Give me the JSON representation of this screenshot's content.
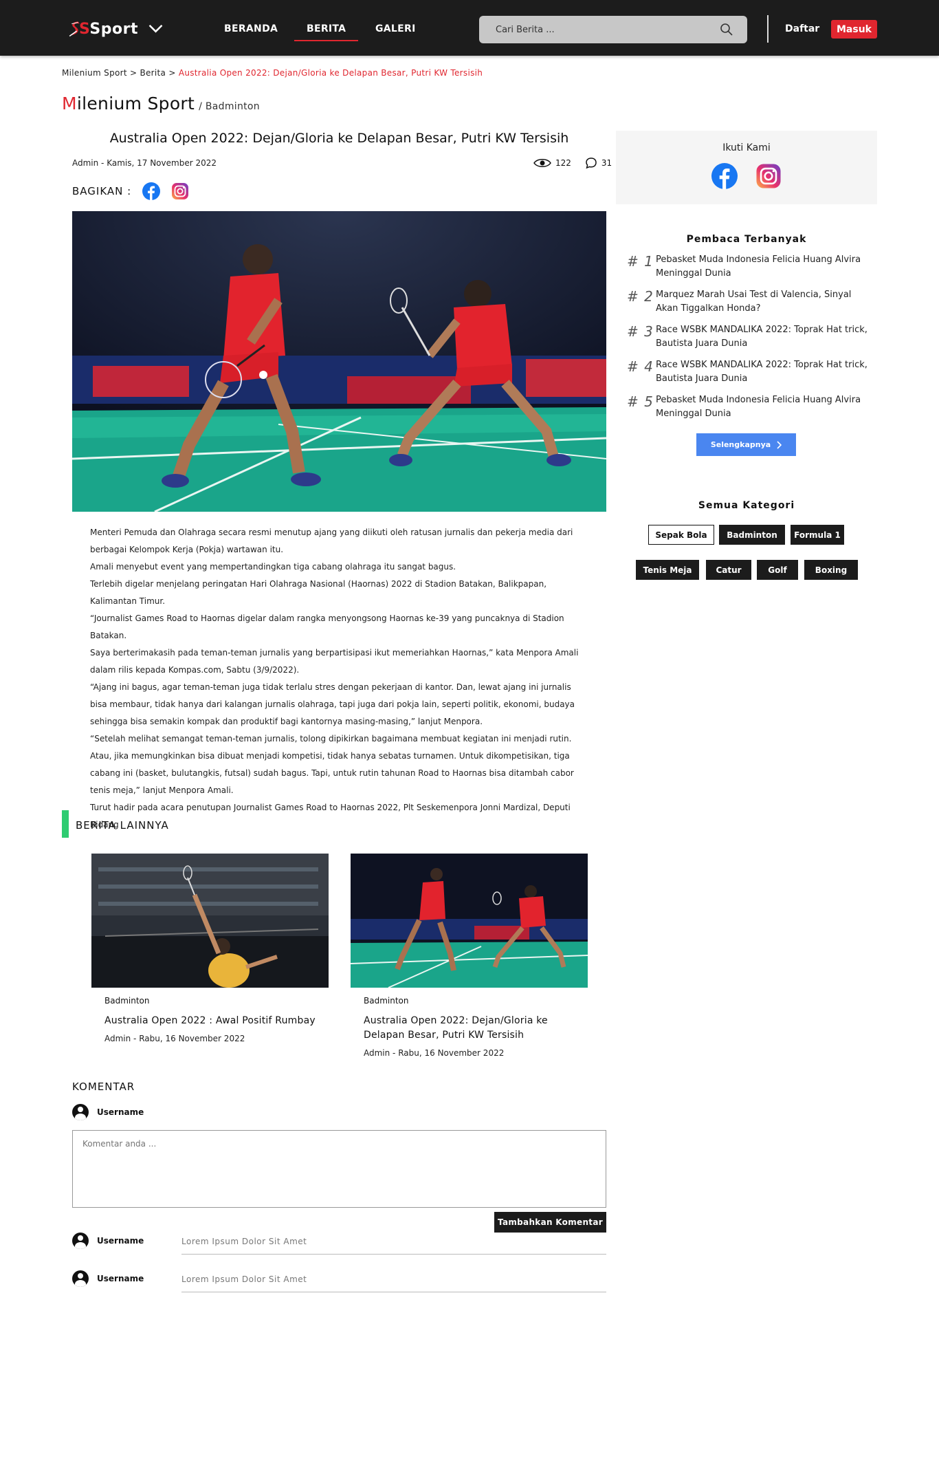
{
  "header": {
    "logo_text": "Sport",
    "nav": [
      "BERANDA",
      "BERITA",
      "GALERI"
    ],
    "search_placeholder": "Cari Berita ...",
    "daftar": "Daftar",
    "masuk": "Masuk"
  },
  "breadcrumb": {
    "home": "Milenium Sport",
    "sep": " > ",
    "section": "Berita",
    "current": "Australia Open 2022: Dejan/Gloria ke Delapan Besar, Putri KW Tersisih"
  },
  "site": {
    "title_first": "M",
    "title_rest": "ilenium Sport",
    "subcategory": "/ Badminton"
  },
  "article": {
    "title": "Australia Open 2022: Dejan/Gloria ke Delapan Besar, Putri KW Tersisih",
    "meta": "Admin - Kamis, 17 November 2022",
    "views": "122",
    "comments": "31",
    "share_label": "BAGIKAN :",
    "paragraphs": [
      "Menteri Pemuda dan Olahraga secara resmi menutup ajang yang diikuti oleh ratusan jurnalis dan pekerja media dari berbagai Kelompok Kerja (Pokja) wartawan itu.",
      "Amali menyebut event yang mempertandingkan tiga cabang olahraga itu sangat bagus.",
      "Terlebih digelar menjelang peringatan Hari Olahraga Nasional (Haornas) 2022 di Stadion Batakan, Balikpapan, Kalimantan Timur.",
      "“Journalist Games Road to Haornas digelar dalam rangka menyongsong Haornas ke-39 yang puncaknya di Stadion Batakan.",
      "Saya berterimakasih pada teman-teman jurnalis yang berpartisipasi ikut memeriahkan Haornas,” kata Menpora Amali dalam rilis kepada Kompas.com, Sabtu (3/9/2022).",
      "“Ajang ini bagus, agar teman-teman juga tidak terlalu stres dengan pekerjaan di kantor. Dan, lewat ajang ini jurnalis bisa membaur, tidak hanya dari kalangan jurnalis olahraga, tapi juga dari pokja lain, seperti politik, ekonomi, budaya sehingga bisa semakin kompak dan produktif bagi kantornya masing-masing,” lanjut Menpora.",
      "“Setelah melihat semangat teman-teman jurnalis, tolong dipikirkan bagaimana membuat kegiatan ini menjadi rutin. Atau, jika memungkinkan bisa dibuat menjadi kompetisi, tidak hanya sebatas turnamen. Untuk dikompetisikan, tiga cabang ini (basket, bulutangkis, futsal) sudah bagus. Tapi, untuk rutin tahunan Road to Haornas bisa ditambah cabor tenis meja,” lanjut Menpora Amali.",
      "Turut hadir pada acara penutupan Journalist Games Road to Haornas 2022, Plt Seskemenpora Jonni Mardizal, Deputi Bidang"
    ]
  },
  "related": {
    "heading": "BERITA LAINNYA",
    "items": [
      {
        "category": "Badminton",
        "title": "Australia Open 2022 : Awal Positif Rumbay",
        "meta": "Admin - Rabu, 16 November 2022"
      },
      {
        "category": "Badminton",
        "title": "Australia Open 2022: Dejan/Gloria ke Delapan Besar, Putri KW Tersisih",
        "meta": "Admin - Rabu, 16 November 2022"
      }
    ]
  },
  "comments": {
    "heading": "KOMENTAR",
    "current_user": "Username",
    "placeholder": "Komentar anda ...",
    "submit": "Tambahkan Komentar",
    "list": [
      {
        "user": "Username",
        "text": "Lorem Ipsum Dolor Sit Amet"
      },
      {
        "user": "Username",
        "text": "Lorem Ipsum Dolor Sit Amet"
      }
    ]
  },
  "sidebar": {
    "follow_title": "Ikuti Kami",
    "popular_title": "Pembaca Terbanyak",
    "popular": [
      {
        "rank": "# 1",
        "title": "Pebasket Muda Indonesia Felicia Huang Alvira Meninggal Dunia"
      },
      {
        "rank": "# 2",
        "title": "Marquez Marah Usai Test di Valencia, Sinyal Akan Tiggalkan Honda?"
      },
      {
        "rank": "# 3",
        "title": "Race WSBK MANDALIKA 2022: Toprak Hat trick, Bautista Juara Dunia"
      },
      {
        "rank": "# 4",
        "title": "Race WSBK MANDALIKA 2022: Toprak Hat trick, Bautista Juara Dunia"
      },
      {
        "rank": "# 5",
        "title": "Pebasket Muda Indonesia Felicia Huang Alvira Meninggal Dunia"
      }
    ],
    "more_button": "Selengkapnya",
    "categories_title": "Semua Kategori",
    "categories": [
      "Sepak Bola",
      "Badminton",
      "Formula 1",
      "Tenis Meja",
      "Catur",
      "Golf",
      "Boxing"
    ]
  },
  "colors": {
    "accent_red": "#e0262f",
    "header_bg": "#1c1c1c",
    "green_bar": "#2ecc71",
    "button_blue": "#4a86f0"
  }
}
